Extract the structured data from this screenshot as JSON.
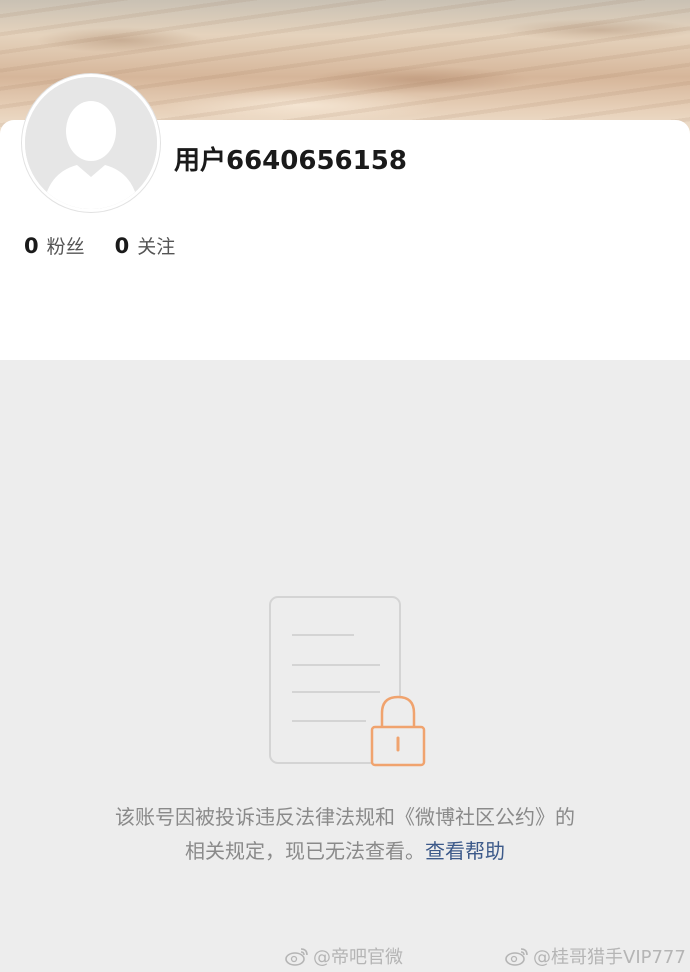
{
  "profile": {
    "username": "用户6640656158",
    "stats": [
      {
        "count": "0",
        "label": "粉丝"
      },
      {
        "count": "0",
        "label": "关注"
      }
    ]
  },
  "notice": {
    "line1": "该账号因被投诉违反法律法规和《微博社区公约》的",
    "line2_prefix": "相关规定，现已无法查看。",
    "help_link": "查看帮助"
  },
  "watermarks": [
    {
      "text": "@帝吧官微",
      "icon": "weibo-logo-icon"
    },
    {
      "text": "@桂哥猎手VIP777",
      "icon": "weibo-logo-icon"
    }
  ],
  "colors": {
    "link": "#3d5a8a",
    "lock": "#f0a36e",
    "background": "#ededed"
  }
}
